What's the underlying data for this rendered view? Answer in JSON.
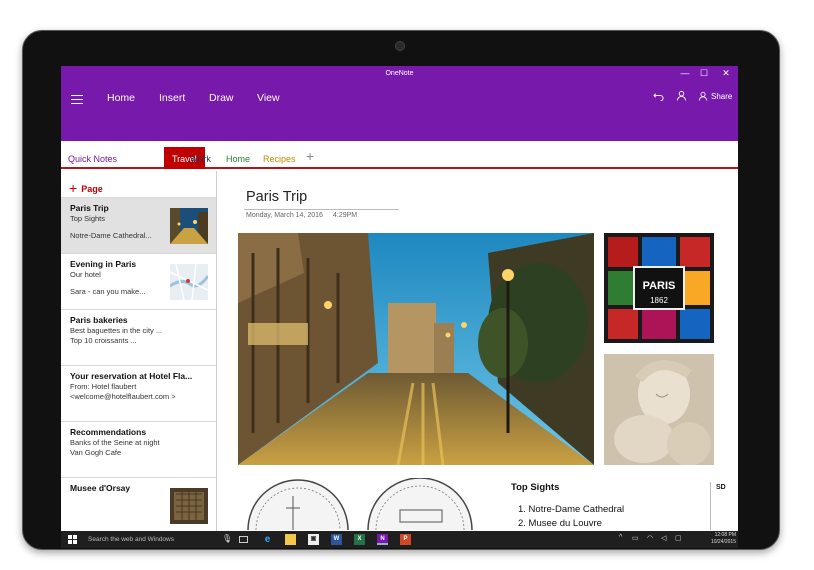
{
  "app": {
    "title": "OneNote",
    "window_controls": {
      "minimize": "—",
      "maximize": "☐",
      "close": "✕"
    }
  },
  "ribbon": {
    "menu": [
      "Home",
      "Insert",
      "Draw",
      "View"
    ],
    "undo_icon": "undo-icon",
    "profile_icon": "person-icon",
    "share_label": "Share"
  },
  "sections": {
    "quick_notes": "Quick Notes",
    "tabs": [
      {
        "label": "Travel",
        "color": "#ffffff",
        "active": true
      },
      {
        "label": "Work",
        "color": "#1f3864"
      },
      {
        "label": "Home",
        "color": "#2e7d32"
      },
      {
        "label": "Recipes",
        "color": "#c58a00"
      }
    ],
    "add_symbol": "+"
  },
  "pages": {
    "add_label": "Page",
    "items": [
      {
        "title": "Paris Trip",
        "line1": "Top Sights",
        "line2": "Notre-Dame Cathedral...",
        "selected": true
      },
      {
        "title": "Evening in Paris",
        "line1": "Our hotel",
        "line2": "Sara - can you make..."
      },
      {
        "title": "Paris bakeries",
        "line1": "Best baguettes in the city ...",
        "line2": "Top 10 croissants ..."
      },
      {
        "title": "Your reservation at Hotel Fla...",
        "line1": "From: Hotel flaubert",
        "line2": "<welcome@hotelflaubert.com >"
      },
      {
        "title": "Recommendations",
        "line1": "Banks of the Seine at night",
        "line2": "Van Gogh Cafe"
      },
      {
        "title": "Musee d'Orsay",
        "line1": "",
        "line2": ""
      }
    ]
  },
  "note": {
    "title": "Paris Trip",
    "date": "Monday, March 14, 2016",
    "time": "4:29PM",
    "sign_text": "PARIS",
    "sign_year": "1862",
    "sights_title": "Top Sights",
    "sights": [
      "1. Notre-Dame Cathedral",
      "2. Musee du Louvre"
    ],
    "side_label": "SD"
  },
  "taskbar": {
    "search_placeholder": "Search the web and Windows",
    "apps": [
      "task-view",
      "edge",
      "file-explorer",
      "store",
      "word",
      "excel",
      "onenote",
      "powerpoint"
    ],
    "time": "12:08 PM",
    "date": "10/24/2015"
  },
  "colors": {
    "onenote_purple": "#7719aa",
    "section_red": "#c00000",
    "taskbar": "#1f1f1f"
  }
}
